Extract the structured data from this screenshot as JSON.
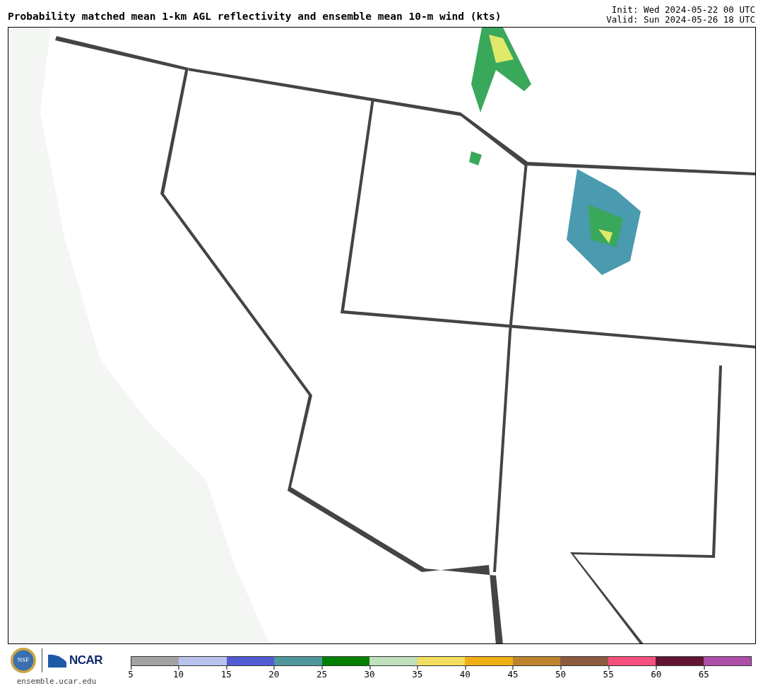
{
  "title": "Probability matched mean 1-km AGL reflectivity and ensemble mean 10-m wind (kts)",
  "init": "Init: Wed 2024-05-22 00 UTC",
  "valid": "Valid: Sun 2024-05-26 18 UTC",
  "logos": {
    "agency": "NSF",
    "lab": "NCAR",
    "url": "ensemble.ucar.edu"
  },
  "colorbar": {
    "segments": [
      {
        "color": "#a3a3a3"
      },
      {
        "color": "#b7c2ee"
      },
      {
        "color": "#525bd4"
      },
      {
        "color": "#4f979c"
      },
      {
        "color": "#007f00"
      },
      {
        "color": "#bfdfbd"
      },
      {
        "color": "#f2dd5e"
      },
      {
        "color": "#f1af16"
      },
      {
        "color": "#bc842f"
      },
      {
        "color": "#8b5a3f"
      },
      {
        "color": "#f5507e"
      },
      {
        "color": "#621532"
      },
      {
        "color": "#ad4ea9"
      }
    ],
    "ticks": [
      "5",
      "10",
      "15",
      "20",
      "25",
      "30",
      "35",
      "40",
      "45",
      "50",
      "55",
      "60",
      "65"
    ]
  }
}
